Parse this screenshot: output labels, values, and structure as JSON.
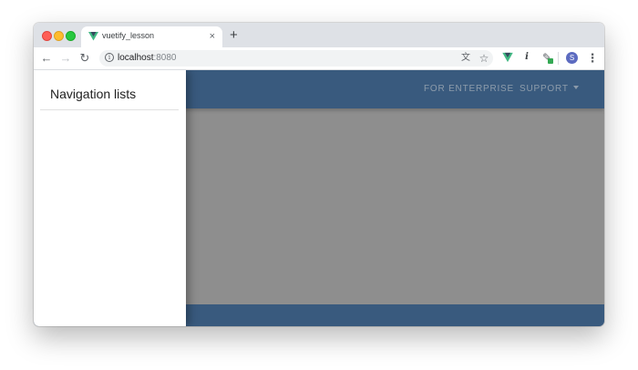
{
  "browser": {
    "tab": {
      "title": "vuetify_lesson",
      "close_glyph": "×",
      "favicon": "vue-logo-icon"
    },
    "new_tab_glyph": "+",
    "toolbar": {
      "back_glyph": "←",
      "forward_glyph": "→",
      "reload_glyph": "↻",
      "info_glyph": "i",
      "url_host": "localhost",
      "url_port": ":8080",
      "translate_glyph": "文",
      "star_glyph": "☆",
      "ext_vue_glyph": "▼",
      "ext_info_glyph": "i",
      "ext_pen_glyph": "✎",
      "avatar_letter": "S",
      "menu_glyph": "⋮"
    }
  },
  "app": {
    "app_bar": {
      "links": [
        {
          "label": "FOR ENTERPRISE"
        },
        {
          "label": "SUPPORT"
        }
      ]
    },
    "drawer": {
      "title": "Navigation lists"
    }
  },
  "colors": {
    "primary": "#1e5086",
    "scrim": "#9e9e9e",
    "vue_green": "#41b883",
    "vue_dark": "#35495e"
  }
}
